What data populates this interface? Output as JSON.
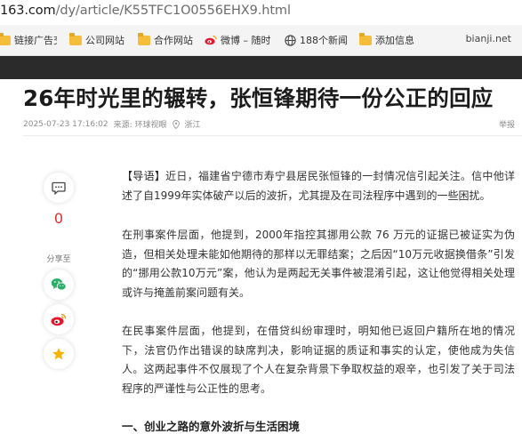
{
  "browser": {
    "url_host": "163.com",
    "url_path": "/dy/article/K55TFC1O0556EHX9.html"
  },
  "bookmarks": {
    "items": [
      {
        "label": "链接广告交",
        "icon": "folder-icon"
      },
      {
        "label": "公司网站",
        "icon": "folder-icon"
      },
      {
        "label": "合作网站",
        "icon": "folder-icon"
      },
      {
        "label": "微博 – 随时",
        "icon": "weibo-icon"
      },
      {
        "label": "188个新闻",
        "icon": "globe-icon"
      },
      {
        "label": "添加信息",
        "icon": "folder-icon"
      }
    ],
    "site_name": "bianji.net"
  },
  "article": {
    "title": "26年时光里的辗转，张恒锋期待一份公正的回应",
    "date": "2025-07-23 17:16:02",
    "source": "来源: 环球视眼",
    "location": "浙江",
    "report_label": "举报",
    "comment_count": "0",
    "share_label": "分享至",
    "paragraphs": [
      {
        "tag": "【导语】",
        "text": "近日，福建省宁德市寿宁县居民张恒锋的一封情况信引起关注。信中他详述了自1999年实体破产以后的波折，尤其提及在司法程序中遇到的一些困扰。"
      },
      {
        "tag": "",
        "text": "在刑事案件层面，他提到，2000年指控其挪用公款 76 万元的证据已被证实为伪造，但相关处理未能如他期待的那样以无罪结案；之后因“10万元收据换借条”引发的“挪用公款10万元”案，他认为是两起无关事件被混淆引起，这让他觉得相关处理或许与掩盖前案问题有关。"
      },
      {
        "tag": "",
        "text": "在民事案件层面，他提到，在借贷纠纷审理时，明知他已返回户籍所在地的情况下，法官仍作出错误的缺席判决，影响证据的质证和事实的认定，使他成为失信人。这两起事件不仅展现了个人在复杂背景下争取权益的艰辛，也引发了关于司法程序的严谨性与公正性的思考。"
      }
    ],
    "section_heading": "一、创业之路的意外波折与生活困境"
  },
  "colors": {
    "nav_band": "#2b2b2b",
    "comment_count": "#e22c2c",
    "wechat": "#2aae67",
    "weibo": "#e6162d",
    "favorite": "#f5b400",
    "folder": "#f4be3a"
  }
}
